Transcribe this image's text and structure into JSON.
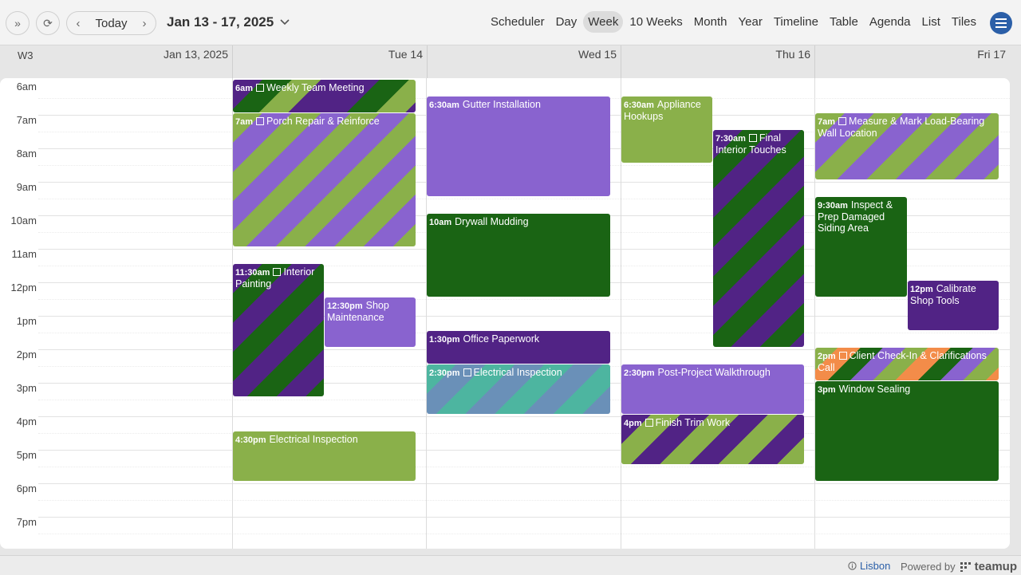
{
  "toolbar": {
    "today_label": "Today",
    "date_range": "Jan 13 - 17, 2025",
    "views": [
      "Scheduler",
      "Day",
      "Week",
      "10 Weeks",
      "Month",
      "Year",
      "Timeline",
      "Table",
      "Agenda",
      "List",
      "Tiles"
    ],
    "active_view": "Week"
  },
  "week_label": "W3",
  "days": [
    "Jan 13, 2025",
    "Tue 14",
    "Wed 15",
    "Thu 16",
    "Fri 17"
  ],
  "hours": [
    "6am",
    "7am",
    "8am",
    "9am",
    "10am",
    "11am",
    "12pm",
    "1pm",
    "2pm",
    "3pm",
    "4pm",
    "5pm",
    "6pm",
    "7pm"
  ],
  "events": [
    {
      "time": "6am",
      "title": "Weekly Team Meeting",
      "recurring": true,
      "style": "s-wtm"
    },
    {
      "time": "7am",
      "title": "Porch Repair & Reinforce",
      "recurring": true,
      "style": "s-gp"
    },
    {
      "time": "11:30am",
      "title": "Interior Painting",
      "recurring": true,
      "style": "s-dpdg"
    },
    {
      "time": "12:30pm",
      "title": "Shop Maintenance",
      "recurring": false,
      "style": "purple"
    },
    {
      "time": "4:30pm",
      "title": "Electrical Inspection",
      "recurring": false,
      "style": "green"
    },
    {
      "time": "6:30am",
      "title": "Gutter Installation",
      "recurring": false,
      "style": "purple"
    },
    {
      "time": "10am",
      "title": "Drywall Mudding",
      "recurring": false,
      "style": "dgreen"
    },
    {
      "time": "1:30pm",
      "title": "Office Paperwork",
      "recurring": false,
      "style": "dpurple"
    },
    {
      "time": "2:30pm",
      "title": "Electrical Inspection",
      "recurring": true,
      "style": "s-tb"
    },
    {
      "time": "6:30am",
      "title": "Appliance Hookups",
      "recurring": false,
      "style": "green"
    },
    {
      "time": "7:30am",
      "title": "Final Interior Touches",
      "recurring": true,
      "style": "s-dpdg"
    },
    {
      "time": "2:30pm",
      "title": "Post-Project Walkthrough",
      "recurring": false,
      "style": "purple"
    },
    {
      "time": "4pm",
      "title": "Finish Trim Work",
      "recurring": true,
      "style": "s-dpg"
    },
    {
      "time": "7am",
      "title": "Measure & Mark Load-Bearing Wall Location",
      "recurring": true,
      "style": "s-gp"
    },
    {
      "time": "9:30am",
      "title": "Inspect & Prep Damaged Siding Area",
      "recurring": false,
      "style": "dgreen"
    },
    {
      "time": "12pm",
      "title": "Calibrate Shop Tools",
      "recurring": false,
      "style": "dpurple"
    },
    {
      "time": "2pm",
      "title": "Client Check-In & Clarifications Call",
      "recurring": true,
      "style": "s-multi"
    },
    {
      "time": "3pm",
      "title": "Window Sealing",
      "recurring": false,
      "style": "dgreen"
    }
  ],
  "footer": {
    "timezone": "Lisbon",
    "powered_by": "Powered by",
    "brand": "teamup"
  }
}
